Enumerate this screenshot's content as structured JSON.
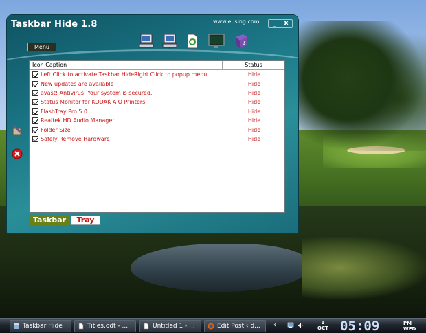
{
  "window": {
    "title": "Taskbar Hide 1.8",
    "site": "www.eusing.com",
    "minimize_label": "_",
    "close_label": "X",
    "menu_label": "Menu"
  },
  "toolbar": {
    "icons": [
      "computer-icon",
      "network-computer-icon",
      "refresh-document-icon",
      "monitor-icon",
      "help-book-icon"
    ]
  },
  "list": {
    "columns": {
      "caption": "Icon Caption",
      "status": "Status"
    },
    "rows": [
      {
        "caption": "Left Click to activate Taskbar HideRight Click to popup menu",
        "status": "Hide"
      },
      {
        "caption": "New updates are available",
        "status": "Hide"
      },
      {
        "caption": "avast! Antivirus: Your system is secured.",
        "status": "Hide"
      },
      {
        "caption": "Status Monitor for KODAK AiO Printers",
        "status": "Hide"
      },
      {
        "caption": "FlashTray Pro 5.0",
        "status": "Hide"
      },
      {
        "caption": "Realtek HD Audio Manager",
        "status": "Hide"
      },
      {
        "caption": "Folder Size",
        "status": "Hide"
      },
      {
        "caption": "Safely Remove Hardware",
        "status": "Hide"
      }
    ]
  },
  "tabs": {
    "taskbar": "Taskbar",
    "tray": "Tray"
  },
  "taskbar": {
    "buttons": [
      {
        "label": "Taskbar Hide",
        "icon": "app-icon"
      },
      {
        "label": "Titles.odt - ...",
        "icon": "document-icon"
      },
      {
        "label": "Untitled 1 - ...",
        "icon": "document-icon"
      },
      {
        "label": "Edit Post ‹ d...",
        "icon": "firefox-icon"
      }
    ],
    "tray_arrow": "‹",
    "date_day": "1",
    "date_month": "OCT",
    "time": "05:09",
    "ampm": "PM",
    "weekday": "WED"
  },
  "colors": {
    "accent_red": "#c81414",
    "tab_green": "#6b8015",
    "window_teal": "#1b7786"
  }
}
